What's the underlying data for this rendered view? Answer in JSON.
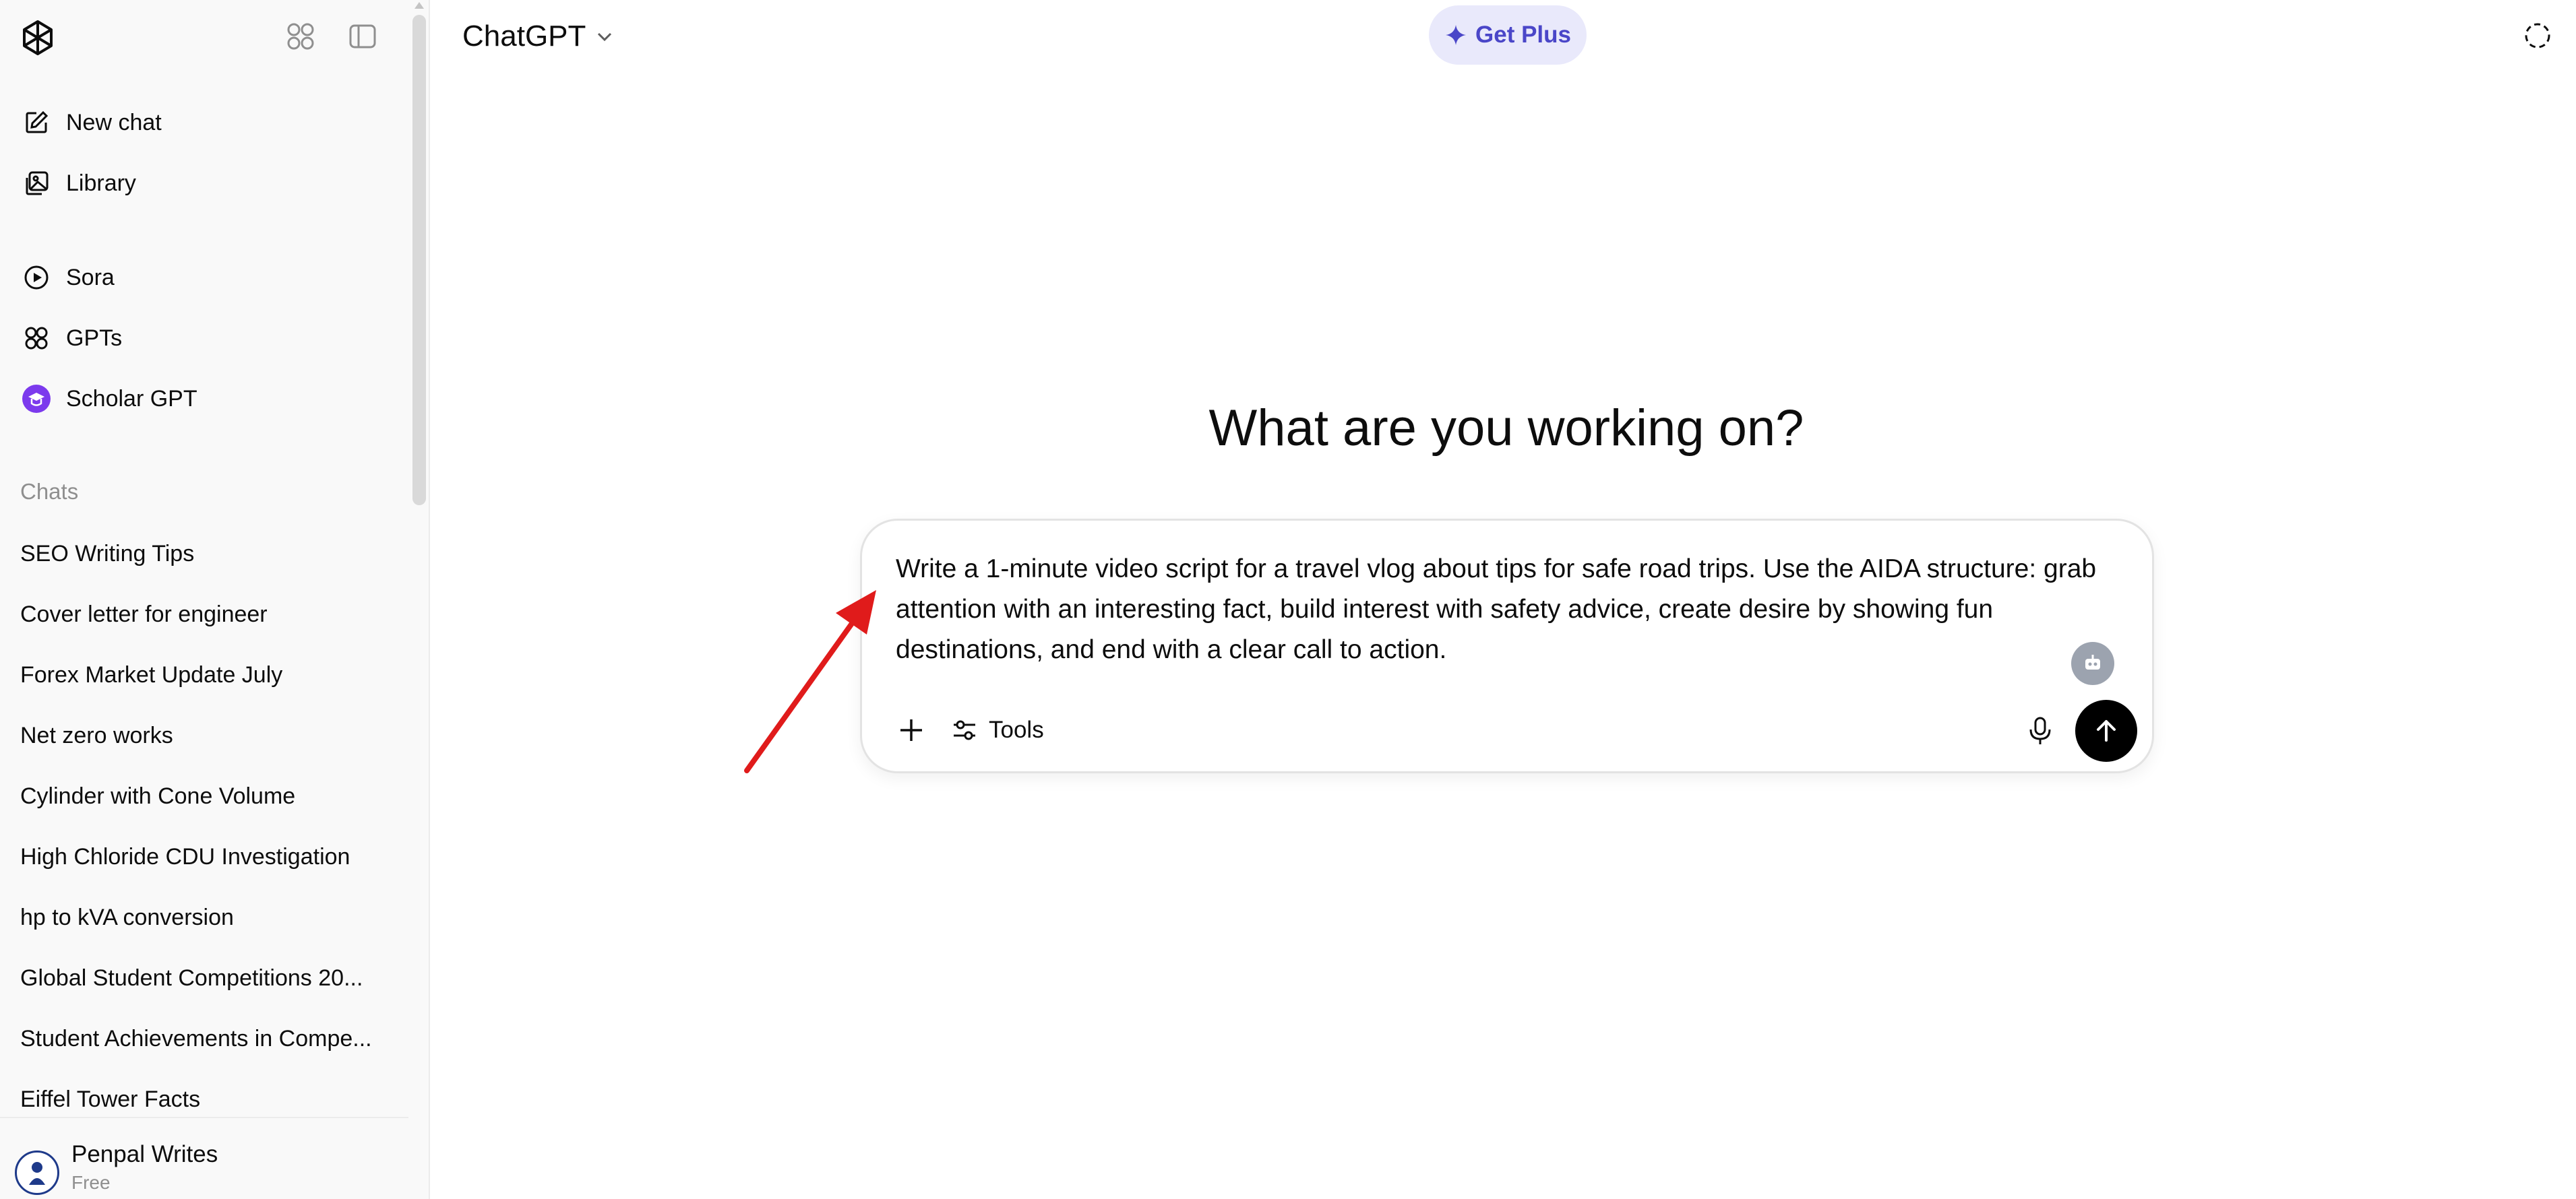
{
  "sidebar": {
    "primary": [
      {
        "label": "New chat",
        "icon": "edit-icon"
      },
      {
        "label": "Library",
        "icon": "library-icon"
      }
    ],
    "apps": [
      {
        "label": "Sora",
        "icon": "play-circle-icon"
      },
      {
        "label": "GPTs",
        "icon": "grid-icon"
      },
      {
        "label": "Scholar GPT",
        "icon": "scholar-gpt-icon"
      }
    ],
    "chats_label": "Chats",
    "chats": [
      "SEO Writing Tips",
      "Cover letter for engineer",
      "Forex Market Update July",
      "Net zero works",
      "Cylinder with Cone Volume",
      "High Chloride CDU Investigation",
      "hp to kVA conversion",
      "Global Student Competitions 20...",
      "Student Achievements in Compe...",
      "Eiffel Tower Facts"
    ],
    "user": {
      "name": "Penpal Writes",
      "plan": "Free"
    }
  },
  "header": {
    "title": "ChatGPT",
    "get_plus": "Get Plus"
  },
  "main": {
    "headline": "What are you working on?",
    "composer": {
      "prompt": "Write a 1-minute video script for a travel vlog about tips for safe road trips. Use the AIDA structure: grab attention with an interesting fact, build interest with safety advice, create desire by showing fun destinations, and end with a clear call to action.",
      "tools_label": "Tools"
    }
  },
  "colors": {
    "accent": "#4a46c8",
    "get_plus_bg": "#e9e9fb",
    "annotation_arrow": "#e01b1b",
    "sidebar_bg": "#f9f9f9"
  }
}
